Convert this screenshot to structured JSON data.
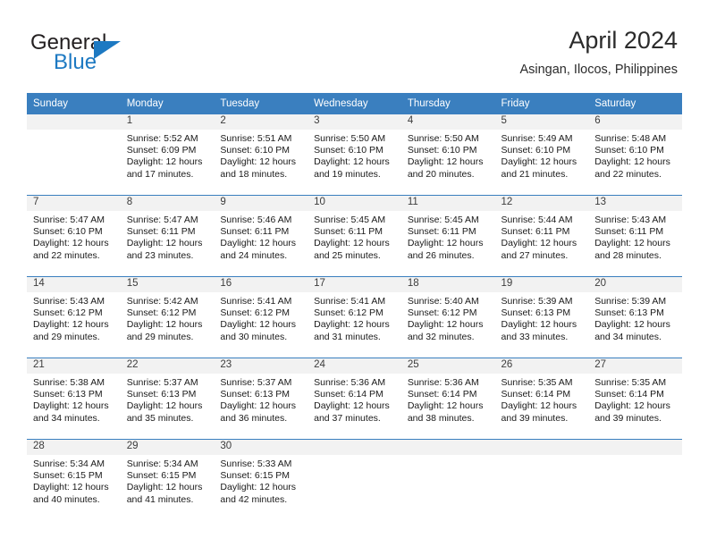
{
  "brand": {
    "name_part1": "General",
    "name_part2": "Blue",
    "accent_color": "#1d79c2"
  },
  "header": {
    "month_title": "April 2024",
    "location": "Asingan, Ilocos, Philippines",
    "header_bg_color": "#3a7fbf"
  },
  "calendar": {
    "weekday_headers": [
      "Sunday",
      "Monday",
      "Tuesday",
      "Wednesday",
      "Thursday",
      "Friday",
      "Saturday"
    ],
    "weeks": [
      [
        {
          "day": "",
          "sunrise": "",
          "sunset": "",
          "daylight": "",
          "empty": true
        },
        {
          "day": "1",
          "sunrise": "Sunrise: 5:52 AM",
          "sunset": "Sunset: 6:09 PM",
          "daylight": "Daylight: 12 hours and 17 minutes."
        },
        {
          "day": "2",
          "sunrise": "Sunrise: 5:51 AM",
          "sunset": "Sunset: 6:10 PM",
          "daylight": "Daylight: 12 hours and 18 minutes."
        },
        {
          "day": "3",
          "sunrise": "Sunrise: 5:50 AM",
          "sunset": "Sunset: 6:10 PM",
          "daylight": "Daylight: 12 hours and 19 minutes."
        },
        {
          "day": "4",
          "sunrise": "Sunrise: 5:50 AM",
          "sunset": "Sunset: 6:10 PM",
          "daylight": "Daylight: 12 hours and 20 minutes."
        },
        {
          "day": "5",
          "sunrise": "Sunrise: 5:49 AM",
          "sunset": "Sunset: 6:10 PM",
          "daylight": "Daylight: 12 hours and 21 minutes."
        },
        {
          "day": "6",
          "sunrise": "Sunrise: 5:48 AM",
          "sunset": "Sunset: 6:10 PM",
          "daylight": "Daylight: 12 hours and 22 minutes."
        }
      ],
      [
        {
          "day": "7",
          "sunrise": "Sunrise: 5:47 AM",
          "sunset": "Sunset: 6:10 PM",
          "daylight": "Daylight: 12 hours and 22 minutes."
        },
        {
          "day": "8",
          "sunrise": "Sunrise: 5:47 AM",
          "sunset": "Sunset: 6:11 PM",
          "daylight": "Daylight: 12 hours and 23 minutes."
        },
        {
          "day": "9",
          "sunrise": "Sunrise: 5:46 AM",
          "sunset": "Sunset: 6:11 PM",
          "daylight": "Daylight: 12 hours and 24 minutes."
        },
        {
          "day": "10",
          "sunrise": "Sunrise: 5:45 AM",
          "sunset": "Sunset: 6:11 PM",
          "daylight": "Daylight: 12 hours and 25 minutes."
        },
        {
          "day": "11",
          "sunrise": "Sunrise: 5:45 AM",
          "sunset": "Sunset: 6:11 PM",
          "daylight": "Daylight: 12 hours and 26 minutes."
        },
        {
          "day": "12",
          "sunrise": "Sunrise: 5:44 AM",
          "sunset": "Sunset: 6:11 PM",
          "daylight": "Daylight: 12 hours and 27 minutes."
        },
        {
          "day": "13",
          "sunrise": "Sunrise: 5:43 AM",
          "sunset": "Sunset: 6:11 PM",
          "daylight": "Daylight: 12 hours and 28 minutes."
        }
      ],
      [
        {
          "day": "14",
          "sunrise": "Sunrise: 5:43 AM",
          "sunset": "Sunset: 6:12 PM",
          "daylight": "Daylight: 12 hours and 29 minutes."
        },
        {
          "day": "15",
          "sunrise": "Sunrise: 5:42 AM",
          "sunset": "Sunset: 6:12 PM",
          "daylight": "Daylight: 12 hours and 29 minutes."
        },
        {
          "day": "16",
          "sunrise": "Sunrise: 5:41 AM",
          "sunset": "Sunset: 6:12 PM",
          "daylight": "Daylight: 12 hours and 30 minutes."
        },
        {
          "day": "17",
          "sunrise": "Sunrise: 5:41 AM",
          "sunset": "Sunset: 6:12 PM",
          "daylight": "Daylight: 12 hours and 31 minutes."
        },
        {
          "day": "18",
          "sunrise": "Sunrise: 5:40 AM",
          "sunset": "Sunset: 6:12 PM",
          "daylight": "Daylight: 12 hours and 32 minutes."
        },
        {
          "day": "19",
          "sunrise": "Sunrise: 5:39 AM",
          "sunset": "Sunset: 6:13 PM",
          "daylight": "Daylight: 12 hours and 33 minutes."
        },
        {
          "day": "20",
          "sunrise": "Sunrise: 5:39 AM",
          "sunset": "Sunset: 6:13 PM",
          "daylight": "Daylight: 12 hours and 34 minutes."
        }
      ],
      [
        {
          "day": "21",
          "sunrise": "Sunrise: 5:38 AM",
          "sunset": "Sunset: 6:13 PM",
          "daylight": "Daylight: 12 hours and 34 minutes."
        },
        {
          "day": "22",
          "sunrise": "Sunrise: 5:37 AM",
          "sunset": "Sunset: 6:13 PM",
          "daylight": "Daylight: 12 hours and 35 minutes."
        },
        {
          "day": "23",
          "sunrise": "Sunrise: 5:37 AM",
          "sunset": "Sunset: 6:13 PM",
          "daylight": "Daylight: 12 hours and 36 minutes."
        },
        {
          "day": "24",
          "sunrise": "Sunrise: 5:36 AM",
          "sunset": "Sunset: 6:14 PM",
          "daylight": "Daylight: 12 hours and 37 minutes."
        },
        {
          "day": "25",
          "sunrise": "Sunrise: 5:36 AM",
          "sunset": "Sunset: 6:14 PM",
          "daylight": "Daylight: 12 hours and 38 minutes."
        },
        {
          "day": "26",
          "sunrise": "Sunrise: 5:35 AM",
          "sunset": "Sunset: 6:14 PM",
          "daylight": "Daylight: 12 hours and 39 minutes."
        },
        {
          "day": "27",
          "sunrise": "Sunrise: 5:35 AM",
          "sunset": "Sunset: 6:14 PM",
          "daylight": "Daylight: 12 hours and 39 minutes."
        }
      ],
      [
        {
          "day": "28",
          "sunrise": "Sunrise: 5:34 AM",
          "sunset": "Sunset: 6:15 PM",
          "daylight": "Daylight: 12 hours and 40 minutes."
        },
        {
          "day": "29",
          "sunrise": "Sunrise: 5:34 AM",
          "sunset": "Sunset: 6:15 PM",
          "daylight": "Daylight: 12 hours and 41 minutes."
        },
        {
          "day": "30",
          "sunrise": "Sunrise: 5:33 AM",
          "sunset": "Sunset: 6:15 PM",
          "daylight": "Daylight: 12 hours and 42 minutes."
        },
        {
          "day": "",
          "sunrise": "",
          "sunset": "",
          "daylight": "",
          "empty": true
        },
        {
          "day": "",
          "sunrise": "",
          "sunset": "",
          "daylight": "",
          "empty": true
        },
        {
          "day": "",
          "sunrise": "",
          "sunset": "",
          "daylight": "",
          "empty": true
        },
        {
          "day": "",
          "sunrise": "",
          "sunset": "",
          "daylight": "",
          "empty": true
        }
      ]
    ]
  }
}
